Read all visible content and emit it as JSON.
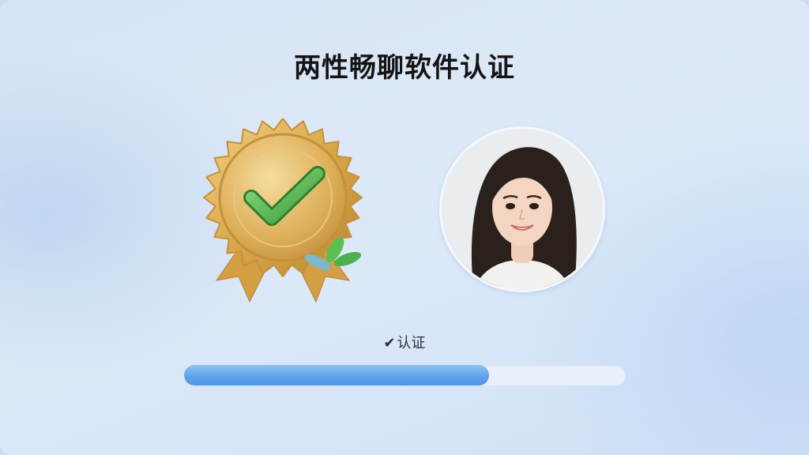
{
  "title": "两性畅聊软件认证",
  "status": {
    "check_glyph": "✔",
    "text": "认证"
  },
  "progress": {
    "fraction": 0.69
  },
  "icons": {
    "badge": "gold-verification-badge-icon",
    "avatar": "user-portrait-avatar"
  },
  "colors": {
    "accent": "#5fa4ea",
    "badge_gold": "#d9a74a",
    "check_green": "#4caf50"
  }
}
